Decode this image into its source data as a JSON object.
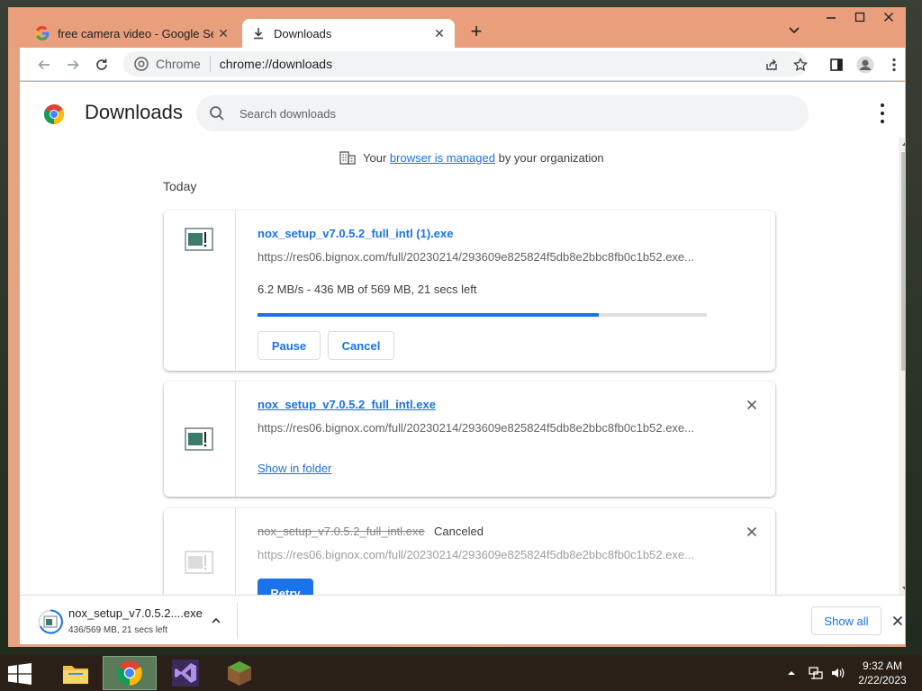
{
  "browser": {
    "tabs": [
      {
        "title": "free camera video - Google Sear",
        "icon": "google-g-icon"
      },
      {
        "title": "Downloads",
        "icon": "download-icon"
      }
    ],
    "omnibox": {
      "site_label": "Chrome",
      "url": "chrome://downloads"
    }
  },
  "downloads_page": {
    "title": "Downloads",
    "search_placeholder": "Search downloads",
    "managed": {
      "prefix": "Your",
      "link": "browser is managed",
      "suffix": "by your organization"
    },
    "section": "Today",
    "items": [
      {
        "filename": "nox_setup_v7.0.5.2_full_intl (1).exe",
        "url": "https://res06.bignox.com/full/20230214/293609e825824f5db8e2bbc8fb0c1b52.exe...",
        "status": "6.2 MB/s - 436 MB of 569 MB, 21 secs left",
        "progress": 0.76,
        "buttons": [
          "Pause",
          "Cancel"
        ]
      },
      {
        "filename": "nox_setup_v7.0.5.2_full_intl.exe",
        "url": "https://res06.bignox.com/full/20230214/293609e825824f5db8e2bbc8fb0c1b52.exe...",
        "action": "Show in folder"
      },
      {
        "filename": "nox_setup_v7.0.5.2_full_intl.exe",
        "state": "Canceled",
        "url": "https://res06.bignox.com/full/20230214/293609e825824f5db8e2bbc8fb0c1b52.exe...",
        "button": "Retry"
      }
    ]
  },
  "shelf": {
    "filename": "nox_setup_v7.0.5.2....exe",
    "status": "436/569 MB, 21 secs left",
    "show_all": "Show all"
  },
  "taskbar": {
    "time": "9:32 AM",
    "date": "2/22/2023",
    "apps": [
      "file-explorer-icon",
      "chrome-icon",
      "visual-studio-icon",
      "minecraft-icon"
    ]
  },
  "colors": {
    "accent": "#1a73e8",
    "frame": "#ea9f7c"
  }
}
